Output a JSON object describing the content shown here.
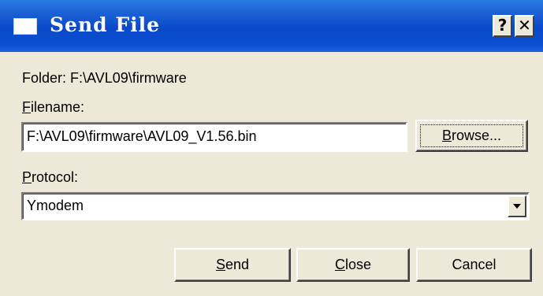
{
  "window": {
    "title": "Send File",
    "help_glyph": "?",
    "close_glyph": "✕"
  },
  "folder": {
    "text": "Folder:  F:\\AVL09\\firmware"
  },
  "filename": {
    "label_accel": "F",
    "label_rest": "ilename:",
    "value": "F:\\AVL09\\firmware\\AVL09_V1.56.bin"
  },
  "browse_button": {
    "accel": "B",
    "rest": "rowse..."
  },
  "protocol": {
    "label_accel": "P",
    "label_rest": "rotocol:",
    "value": "Ymodem"
  },
  "buttons": {
    "send_accel": "S",
    "send_rest": "end",
    "close_accel": "C",
    "close_rest": "lose",
    "cancel": "Cancel"
  }
}
